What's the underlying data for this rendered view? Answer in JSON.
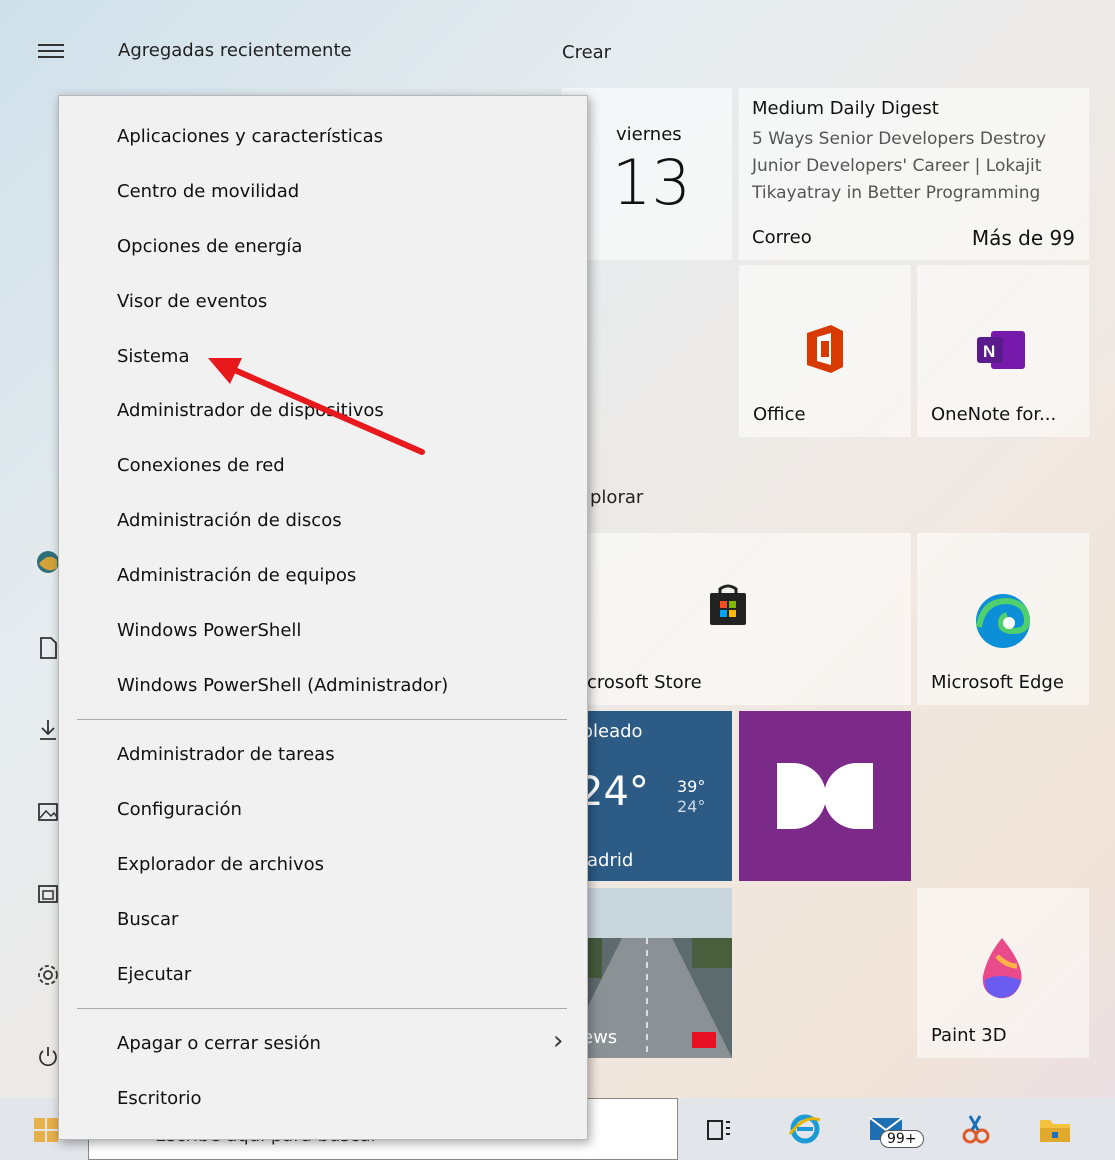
{
  "left_column": {
    "header": "Agregadas recientemente"
  },
  "right_column": {
    "create_header": "Crear",
    "explore_header": "plorar"
  },
  "tiles": {
    "calendar": {
      "day_name": "viernes",
      "day_number": "13"
    },
    "mail": {
      "title": "Medium Daily Digest",
      "body_lines": [
        "5 Ways Senior Developers Destroy",
        "Junior Developers' Career | Lokajit",
        "Tikayatray in Better Programming"
      ],
      "app_label": "Correo",
      "count": "Más de 99"
    },
    "office": {
      "label": "Office"
    },
    "onenote": {
      "label": "OneNote for..."
    },
    "store": {
      "label": "icrosoft Store"
    },
    "edge": {
      "label": "Microsoft Edge"
    },
    "weather": {
      "condition": "oleado",
      "temp": "24°",
      "high": "39°",
      "low": "24°",
      "city": "ladrid"
    },
    "news": {
      "label": "ews"
    },
    "paint3d": {
      "label": "Paint 3D"
    }
  },
  "context_menu": {
    "items": [
      "Aplicaciones y características",
      "Centro de movilidad",
      "Opciones de energía",
      "Visor de eventos",
      "Sistema",
      "Administrador de dispositivos",
      "Conexiones de red",
      "Administración de discos",
      "Administración de equipos",
      "Windows PowerShell",
      "Windows PowerShell (Administrador)",
      "Administrador de tareas",
      "Configuración",
      "Explorador de archivos",
      "Buscar",
      "Ejecutar",
      "Apagar o cerrar sesión",
      "Escritorio"
    ],
    "submenu_chevron": "›"
  },
  "taskbar": {
    "search_placeholder": "Escribe aquí para buscar",
    "mail_badge": "99+"
  },
  "colors": {
    "arrow": "#e8191d",
    "dolby_bg": "#7b2a8a",
    "weather_bg": "#2c5b86"
  }
}
